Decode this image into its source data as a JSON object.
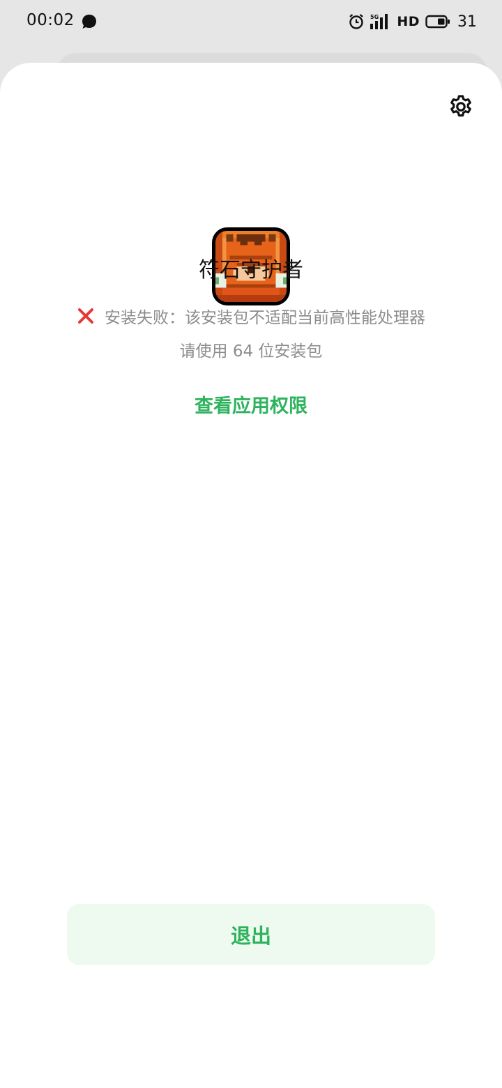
{
  "status_bar": {
    "time": "00:02",
    "network": "5G",
    "hd": "HD",
    "battery": "31"
  },
  "app": {
    "name": "符石守护者",
    "icon": "pixel-monster-app-icon"
  },
  "error": {
    "message": "安装失败：该安装包不适配当前高性能处理器",
    "hint": "请使用 64 位安装包"
  },
  "actions": {
    "view_permissions": "查看应用权限",
    "exit": "退出"
  },
  "colors": {
    "accent": "#2db35d",
    "error": "#e53935",
    "muted_text": "#8c8c8c",
    "exit_bg": "#eefaf0"
  }
}
